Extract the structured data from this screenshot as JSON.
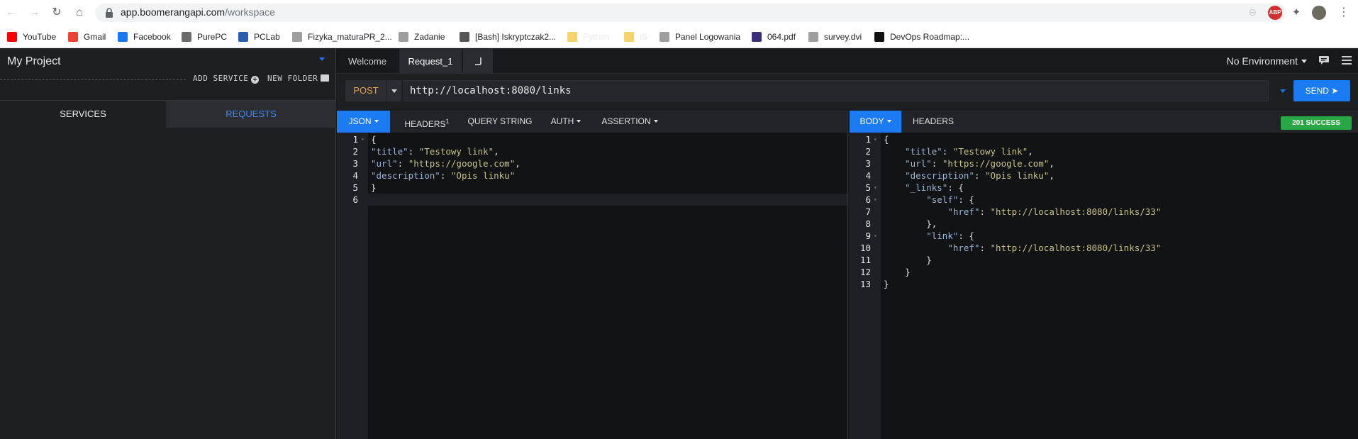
{
  "browser": {
    "url_host": "app.boomerangapi.com",
    "url_path": "/workspace",
    "ext_abp_label": "ABP"
  },
  "bookmarks": [
    {
      "label": "YouTube",
      "color": "#ff0000"
    },
    {
      "label": "Gmail",
      "color": "#ea4335"
    },
    {
      "label": "Facebook",
      "color": "#1877f2"
    },
    {
      "label": "PurePC",
      "color": "#6b6b6b"
    },
    {
      "label": "PCLab",
      "color": "#2a5db0"
    },
    {
      "label": "Fizyka_maturaPR_2...",
      "color": "#9e9e9e"
    },
    {
      "label": "Zadanie",
      "color": "#9e9e9e"
    },
    {
      "label": "[Bash] Iskryptczak2...",
      "color": "#555555"
    },
    {
      "label": "Python",
      "color": "#f6d36b"
    },
    {
      "label": "IS",
      "color": "#f6d36b"
    },
    {
      "label": "Panel Logowania",
      "color": "#9e9e9e"
    },
    {
      "label": "064.pdf",
      "color": "#3b2d7a"
    },
    {
      "label": "survey.dvi",
      "color": "#9e9e9e"
    },
    {
      "label": "DevOps Roadmap:...",
      "color": "#111111"
    }
  ],
  "sidebar": {
    "project_title": "My Project",
    "add_service": "ADD SERVICE",
    "new_folder": "NEW FOLDER",
    "tab_services": "SERVICES",
    "tab_requests": "REQUESTS"
  },
  "tabs": {
    "welcome": "Welcome",
    "request": "Request_1",
    "environment": "No Environment"
  },
  "request": {
    "method": "POST",
    "url": "http://localhost:8080/links",
    "send_label": "SEND ➤"
  },
  "left_pane": {
    "tabs": [
      "JSON",
      "HEADERS",
      "QUERY STRING",
      "AUTH",
      "ASSERTION"
    ],
    "headers_count": "1",
    "lines": [
      "{",
      "\"title\": \"Testowy link\",",
      "\"url\": \"https://google.com\",",
      "\"description\": \"Opis linku\"",
      "}",
      ""
    ]
  },
  "right_pane": {
    "tabs": [
      "BODY",
      "HEADERS"
    ],
    "status": "201 SUCCESS",
    "lines": [
      "{",
      "    \"title\": \"Testowy link\",",
      "    \"url\": \"https://google.com\",",
      "    \"description\": \"Opis linku\",",
      "    \"_links\": {",
      "        \"self\": {",
      "            \"href\": \"http://localhost:8080/links/33\"",
      "        },",
      "        \"link\": {",
      "            \"href\": \"http://localhost:8080/links/33\"",
      "        }",
      "    }",
      "}"
    ]
  }
}
